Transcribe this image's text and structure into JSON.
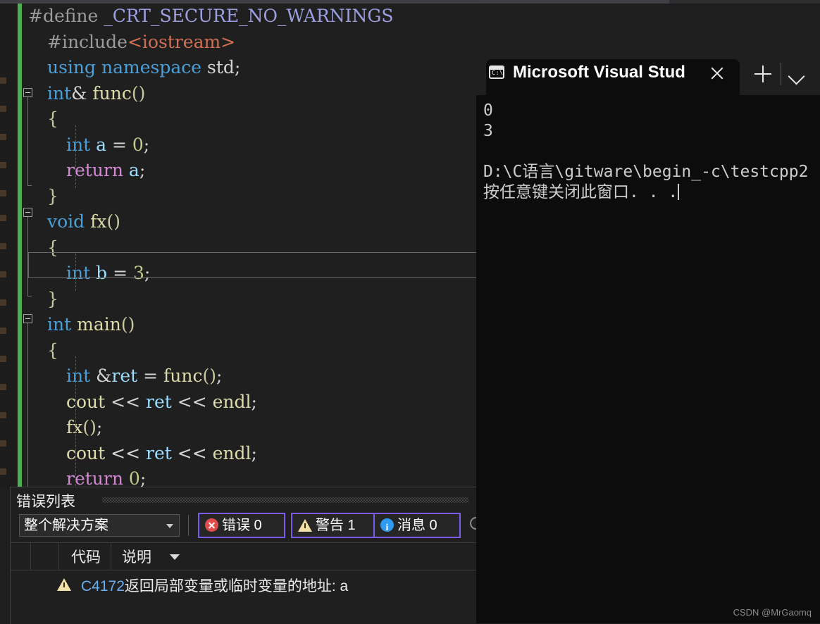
{
  "editor": {
    "name": "code-editor",
    "language": "cpp",
    "current_line_index": 9,
    "lines": [
      {
        "indent": 0,
        "tokens": [
          {
            "t": "#define ",
            "c": "pp"
          },
          {
            "t": "_CRT_SECURE_NO_WARNINGS",
            "c": "mac"
          }
        ]
      },
      {
        "indent": 1,
        "tokens": [
          {
            "t": "#include",
            "c": "pp"
          },
          {
            "t": "<iostream>",
            "c": "str"
          }
        ]
      },
      {
        "indent": 1,
        "tokens": [
          {
            "t": "using",
            "c": "kw"
          },
          {
            "t": " ",
            "c": "op"
          },
          {
            "t": "namespace",
            "c": "kw"
          },
          {
            "t": " ",
            "c": "op"
          },
          {
            "t": "std",
            "c": "pun"
          },
          {
            "t": ";",
            "c": "op"
          }
        ]
      },
      {
        "indent": 1,
        "tokens": [
          {
            "t": "int",
            "c": "typ"
          },
          {
            "t": "&",
            "c": "op"
          },
          {
            "t": " ",
            "c": "op"
          },
          {
            "t": "func",
            "c": "fn"
          },
          {
            "t": "()",
            "c": "brc"
          }
        ]
      },
      {
        "indent": 1,
        "tokens": [
          {
            "t": "{",
            "c": "brc"
          }
        ]
      },
      {
        "indent": 2,
        "tokens": [
          {
            "t": "int",
            "c": "typ"
          },
          {
            "t": " ",
            "c": "op"
          },
          {
            "t": "a",
            "c": "var"
          },
          {
            "t": " = ",
            "c": "op"
          },
          {
            "t": "0",
            "c": "num"
          },
          {
            "t": ";",
            "c": "op"
          }
        ]
      },
      {
        "indent": 2,
        "tokens": [
          {
            "t": "return",
            "c": "ret"
          },
          {
            "t": " ",
            "c": "op"
          },
          {
            "t": "a",
            "c": "var"
          },
          {
            "t": ";",
            "c": "op"
          }
        ]
      },
      {
        "indent": 1,
        "tokens": [
          {
            "t": "}",
            "c": "brc"
          }
        ]
      },
      {
        "indent": 1,
        "tokens": [
          {
            "t": "void",
            "c": "typ"
          },
          {
            "t": " ",
            "c": "op"
          },
          {
            "t": "fx",
            "c": "fn"
          },
          {
            "t": "()",
            "c": "brc"
          }
        ]
      },
      {
        "indent": 1,
        "tokens": [
          {
            "t": "{",
            "c": "brc"
          }
        ]
      },
      {
        "indent": 2,
        "tokens": [
          {
            "t": "int",
            "c": "typ"
          },
          {
            "t": " ",
            "c": "op"
          },
          {
            "t": "b",
            "c": "var"
          },
          {
            "t": " = ",
            "c": "op"
          },
          {
            "t": "3",
            "c": "num"
          },
          {
            "t": ";",
            "c": "op"
          }
        ]
      },
      {
        "indent": 1,
        "tokens": [
          {
            "t": "}",
            "c": "brc"
          }
        ]
      },
      {
        "indent": 1,
        "tokens": [
          {
            "t": "int",
            "c": "typ"
          },
          {
            "t": " ",
            "c": "op"
          },
          {
            "t": "main",
            "c": "fn"
          },
          {
            "t": "()",
            "c": "brc"
          }
        ]
      },
      {
        "indent": 1,
        "tokens": [
          {
            "t": "{",
            "c": "brc"
          }
        ]
      },
      {
        "indent": 2,
        "tokens": [
          {
            "t": "int",
            "c": "typ"
          },
          {
            "t": " ",
            "c": "op"
          },
          {
            "t": "&",
            "c": "op"
          },
          {
            "t": "ret",
            "c": "var"
          },
          {
            "t": " = ",
            "c": "op"
          },
          {
            "t": "func",
            "c": "fn"
          },
          {
            "t": "()",
            "c": "brc"
          },
          {
            "t": ";",
            "c": "op"
          }
        ]
      },
      {
        "indent": 2,
        "tokens": [
          {
            "t": "cout",
            "c": "fn"
          },
          {
            "t": " << ",
            "c": "op"
          },
          {
            "t": "ret",
            "c": "var"
          },
          {
            "t": " << ",
            "c": "op"
          },
          {
            "t": "endl",
            "c": "fn"
          },
          {
            "t": ";",
            "c": "op"
          }
        ]
      },
      {
        "indent": 2,
        "tokens": [
          {
            "t": "fx",
            "c": "fn"
          },
          {
            "t": "()",
            "c": "brc"
          },
          {
            "t": ";",
            "c": "op"
          }
        ]
      },
      {
        "indent": 2,
        "tokens": [
          {
            "t": "cout",
            "c": "fn"
          },
          {
            "t": " << ",
            "c": "op"
          },
          {
            "t": "ret",
            "c": "var"
          },
          {
            "t": " << ",
            "c": "op"
          },
          {
            "t": "endl",
            "c": "fn"
          },
          {
            "t": ";",
            "c": "op"
          }
        ]
      },
      {
        "indent": 2,
        "tokens": [
          {
            "t": "return",
            "c": "ret"
          },
          {
            "t": " ",
            "c": "op"
          },
          {
            "t": "0",
            "c": "num"
          },
          {
            "t": ";",
            "c": "op"
          }
        ]
      }
    ]
  },
  "console": {
    "tab_title": "Microsoft Visual Stud",
    "tab_icon": "console-prompt-icon",
    "close_icon": "close-icon",
    "new_tab_icon": "plus-icon",
    "dropdown_icon": "chevron-down-icon",
    "output_lines": [
      "0",
      "3",
      "",
      "D:\\C语言\\gitware\\begin_-c\\testcpp2",
      "按任意键关闭此窗口. . ."
    ]
  },
  "error_list": {
    "title": "错误列表",
    "scope_filter": {
      "value": "整个解决方案",
      "caret_icon": "chevron-down-icon"
    },
    "severity_buttons": [
      {
        "name": "errors-filter",
        "icon": "error-circle-icon",
        "label": "错误 0"
      },
      {
        "name": "warnings-filter",
        "icon": "warning-triangle-icon",
        "label": "警告 1"
      },
      {
        "name": "messages-filter",
        "icon": "info-circle-icon",
        "label": "消息 0"
      }
    ],
    "search_icon": "search-icon",
    "columns": [
      "",
      "",
      "代码",
      "说明"
    ],
    "sort_caret_icon": "sort-descending-caret-icon",
    "rows": [
      {
        "severity_icon": "warning-triangle-icon",
        "code": "C4172",
        "description": "返回局部变量或临时变量的地址: a"
      }
    ]
  },
  "watermark": {
    "text": "CSDN @MrGaomq"
  },
  "colors": {
    "editor_background": "#1f1f1f",
    "console_background": "#0c0c0c",
    "change_bar_green": "#4caf50",
    "filter_button_border": "#7b5cf0",
    "error_red": "#e04b4b",
    "warning_yellow": "#f3e0a8",
    "info_blue": "#2f9bf0",
    "code_link_blue": "#6aaef0"
  }
}
